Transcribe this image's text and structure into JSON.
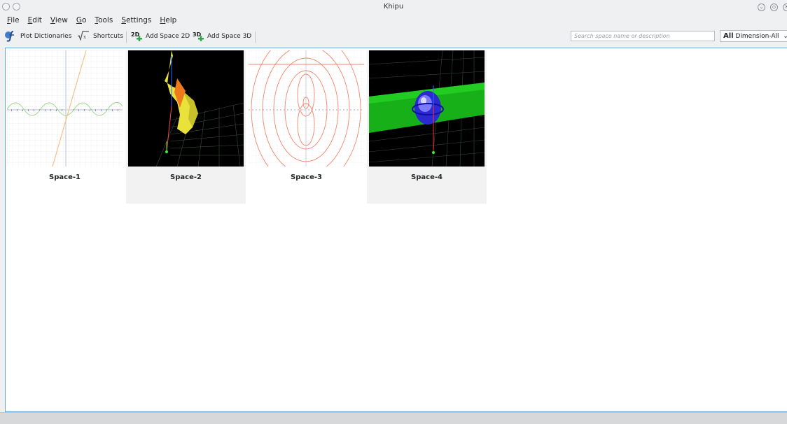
{
  "window": {
    "title": "Khipu"
  },
  "menubar": {
    "items": [
      {
        "accel": "F",
        "rest": "ile"
      },
      {
        "accel": "E",
        "rest": "dit"
      },
      {
        "accel": "V",
        "rest": "iew"
      },
      {
        "accel": "G",
        "rest": "o"
      },
      {
        "accel": "T",
        "rest": "ools"
      },
      {
        "accel": "S",
        "rest": "ettings"
      },
      {
        "accel": "H",
        "rest": "elp"
      }
    ]
  },
  "toolbar": {
    "plot_dictionaries": "Plot Dictionaries",
    "shortcuts": "Shortcuts",
    "add_space_2d": "Add Space 2D",
    "add_space_3d": "Add Space 3D",
    "badge_2d": "2D",
    "badge_3d": "3D",
    "search_placeholder": "Search space name or description",
    "dimension_prefix": "All",
    "dimension_value": "Dimension-All"
  },
  "spaces": [
    {
      "name": "Space-1",
      "type": "2d",
      "selected": false
    },
    {
      "name": "Space-2",
      "type": "3d",
      "selected": true
    },
    {
      "name": "Space-3",
      "type": "2d",
      "selected": false
    },
    {
      "name": "Space-4",
      "type": "3d",
      "selected": true
    }
  ]
}
